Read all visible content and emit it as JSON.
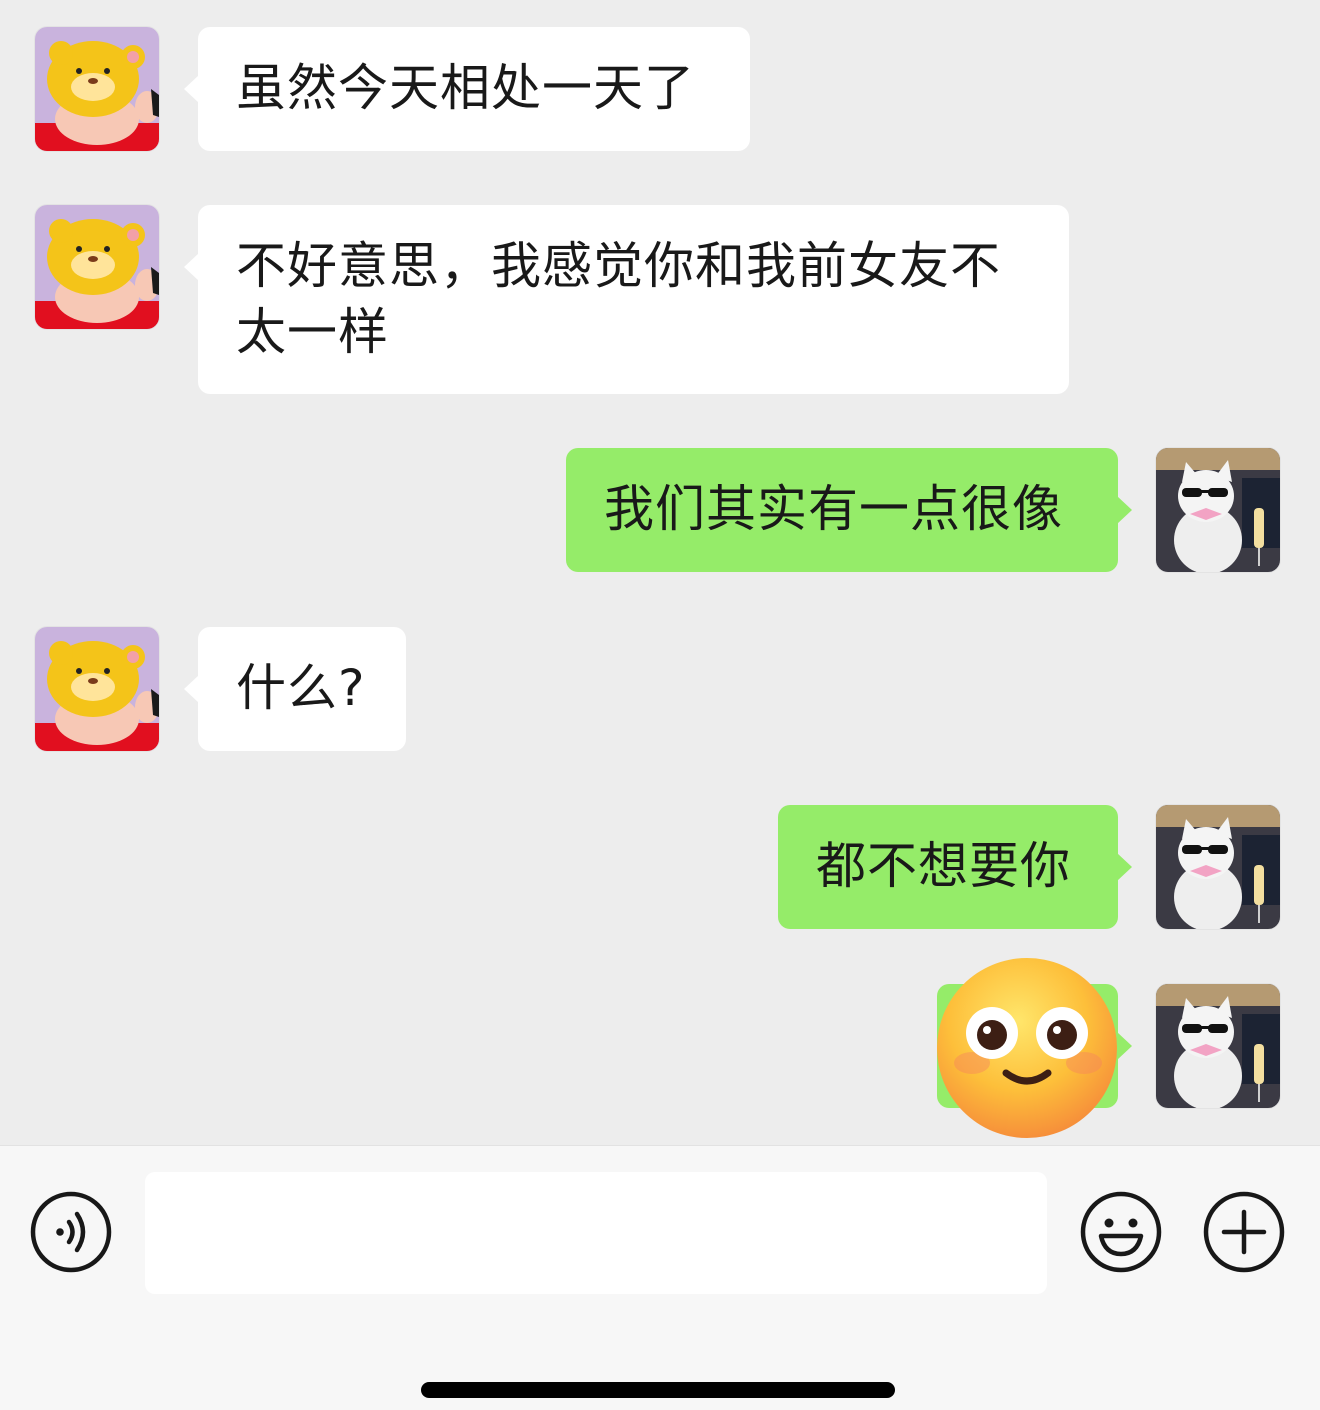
{
  "messages": [
    {
      "side": "in",
      "text": "虽然今天相处一天了"
    },
    {
      "side": "in",
      "text": "不好意思，我感觉你和我前女友不太一样"
    },
    {
      "side": "out",
      "text": "我们其实有一点很像"
    },
    {
      "side": "in",
      "text": "什么?"
    },
    {
      "side": "out",
      "text": "都不想要你"
    },
    {
      "side": "out",
      "sticker": "smiling-face-emoji"
    }
  ],
  "avatars": {
    "contact": "yellow-cartoon-bear-avatar",
    "self": "white-cat-sunglasses-avatar"
  },
  "input_bar": {
    "placeholder": "",
    "voice_icon": "voice-icon",
    "emoji_icon": "emoji-icon",
    "plus_icon": "plus-icon"
  },
  "colors": {
    "background": "#ededed",
    "incoming_bubble": "#ffffff",
    "outgoing_bubble": "#95ec69",
    "input_bar": "#f7f7f7"
  }
}
